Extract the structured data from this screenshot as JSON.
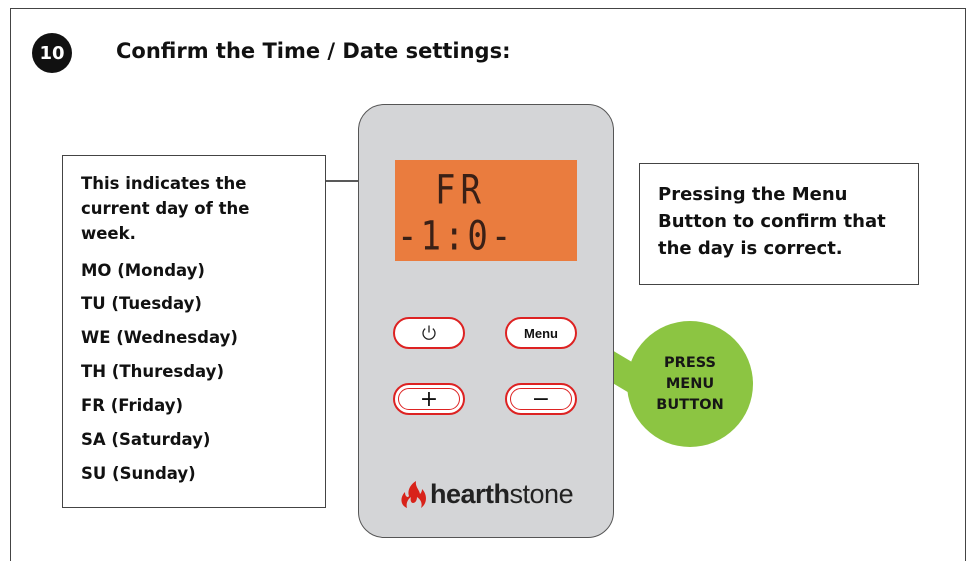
{
  "header": {
    "step_number": "10",
    "title": "Confirm the Time / Date settings:"
  },
  "display": {
    "line1": "FR",
    "line2": "-1:0-"
  },
  "buttons": {
    "menu_label": "Menu",
    "plus_label": "+",
    "minus_label": "−"
  },
  "day_info": {
    "lines": [
      "This indicates the",
      "current day of the",
      "week."
    ],
    "days": [
      "MO (Monday)",
      "TU (Tuesday)",
      "WE (Wednesday)",
      "TH (Thuresday)",
      "FR (Friday)",
      "SA (Saturday)",
      "SU (Sunday)"
    ]
  },
  "instruction": {
    "lines": [
      "Pressing the Menu",
      "Button to confirm that",
      "the day is correct."
    ]
  },
  "press": {
    "lines": [
      "PRESS",
      "MENU",
      "BUTTON"
    ]
  },
  "colors": {
    "lcd": "#ea7c3e",
    "press": "#8cc542",
    "button_border": "#dd2222",
    "remote": "#d4d5d7"
  },
  "brand": {
    "logo_text": "hearthstone",
    "logo_icon": "flame-icon"
  }
}
